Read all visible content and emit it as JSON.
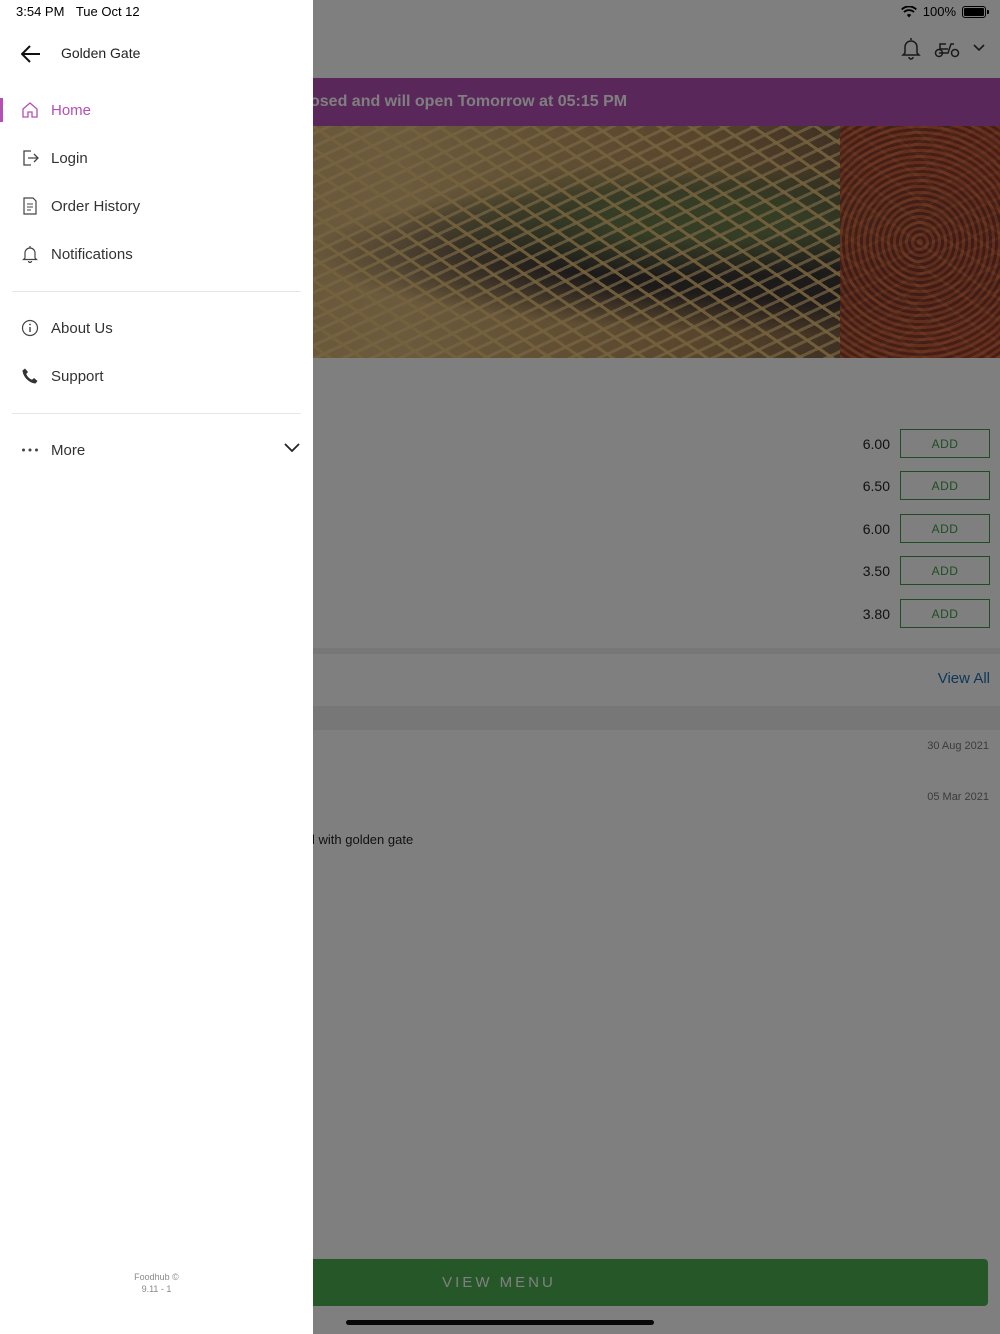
{
  "status_bar": {
    "time": "3:54 PM",
    "date": "Tue Oct 12",
    "battery": "100%"
  },
  "drawer": {
    "title": "Golden Gate",
    "primary_items": [
      {
        "label": "Home",
        "icon": "home-icon",
        "active": true
      },
      {
        "label": "Login",
        "icon": "login-icon",
        "active": false
      },
      {
        "label": "Order History",
        "icon": "order-history-icon",
        "active": false
      },
      {
        "label": "Notifications",
        "icon": "bell-icon",
        "active": false
      }
    ],
    "secondary_items": [
      {
        "label": "About Us",
        "icon": "info-icon"
      },
      {
        "label": "Support",
        "icon": "phone-icon"
      }
    ],
    "more_label": "More",
    "footer": {
      "line1": "Foodhub ©",
      "line2": "9.11 - 1"
    }
  },
  "background": {
    "closed_banner": "osed and will open Tomorrow at 05:15 PM",
    "items": [
      {
        "price": "6.00",
        "button": "ADD"
      },
      {
        "price": "6.50",
        "button": "ADD"
      },
      {
        "price": "6.00",
        "button": "ADD"
      },
      {
        "price": "3.50",
        "button": "ADD"
      },
      {
        "price": "3.80",
        "button": "ADD"
      }
    ],
    "view_all": "View All",
    "notifications": [
      {
        "date": "30 Aug 2021"
      },
      {
        "date": "05 Mar 2021"
      }
    ],
    "notification_text": "l with golden gate",
    "view_menu": "VIEW MENU"
  },
  "colors": {
    "accent": "#b54fb7",
    "green": "#4caf50",
    "link": "#1a6fb0"
  }
}
